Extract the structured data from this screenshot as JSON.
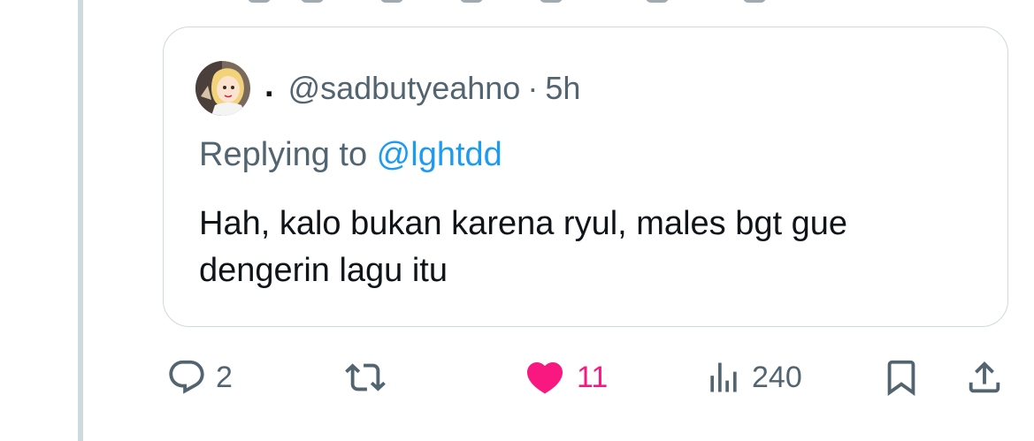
{
  "quoted_tweet": {
    "display_name": ".",
    "handle": "@sadbutyeahno",
    "separator": "·",
    "time": "5h",
    "replying_prefix": "Replying to ",
    "replying_mention": "@lghtdd",
    "text_line1": "Hah, kalo bukan karena ryul, males bgt gue",
    "text_line2": "dengerin lagu itu"
  },
  "actions": {
    "reply_count": "2",
    "retweet_count": "",
    "like_count": "11",
    "views_count": "240"
  },
  "colors": {
    "text_primary": "#0f1419",
    "text_secondary": "#536471",
    "mention": "#1d9bf0",
    "like_active": "#f91880",
    "border": "#cfd9de"
  },
  "icons": [
    "reply-icon",
    "retweet-icon",
    "heart-filled-icon",
    "views-icon",
    "bookmark-icon",
    "share-icon"
  ]
}
